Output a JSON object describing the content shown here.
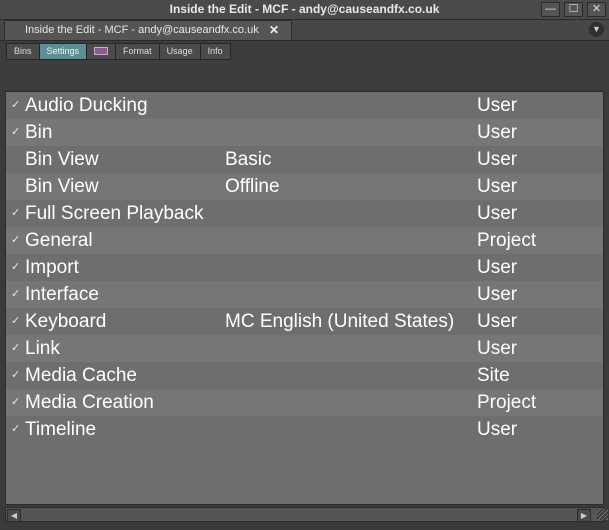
{
  "window": {
    "title": "Inside the Edit - MCF - andy@causeandfx.co.uk",
    "minimize_glyph": "—",
    "maximize_glyph": "☐",
    "close_glyph": "✕"
  },
  "doc_tab": {
    "label": "Inside the Edit - MCF - andy@causeandfx.co.uk",
    "close_glyph": "✕",
    "menu_glyph": "▼"
  },
  "subtabs": [
    {
      "label": "Bins",
      "active": false
    },
    {
      "label": "Settings",
      "active": true
    },
    {
      "label": "",
      "icon": "media-composer-icon",
      "active": false
    },
    {
      "label": "Format",
      "active": false
    },
    {
      "label": "Usage",
      "active": false
    },
    {
      "label": "Info",
      "active": false
    }
  ],
  "settings": [
    {
      "checked": true,
      "name": "Audio Ducking",
      "value": "",
      "type": "User"
    },
    {
      "checked": true,
      "name": "Bin",
      "value": "",
      "type": "User"
    },
    {
      "checked": false,
      "name": "Bin View",
      "value": "Basic",
      "type": "User"
    },
    {
      "checked": false,
      "name": "Bin View",
      "value": "Offline",
      "type": "User"
    },
    {
      "checked": true,
      "name": "Full Screen Playback",
      "value": "",
      "type": "User"
    },
    {
      "checked": true,
      "name": "General",
      "value": "",
      "type": "Project"
    },
    {
      "checked": true,
      "name": "Import",
      "value": "",
      "type": "User"
    },
    {
      "checked": true,
      "name": "Interface",
      "value": "",
      "type": "User"
    },
    {
      "checked": true,
      "name": "Keyboard",
      "value": "MC English (United States)",
      "type": "User"
    },
    {
      "checked": true,
      "name": "Link",
      "value": "",
      "type": "User"
    },
    {
      "checked": true,
      "name": "Media Cache",
      "value": "",
      "type": "Site"
    },
    {
      "checked": true,
      "name": "Media Creation",
      "value": "",
      "type": "Project"
    },
    {
      "checked": true,
      "name": "Timeline",
      "value": "",
      "type": "User"
    }
  ],
  "check_glyph": "✓",
  "scrollbar": {
    "left_glyph": "◀",
    "right_glyph": "▶"
  },
  "colors": {
    "active_tab": "#5d8f94",
    "list_bg": "#6e6e6e",
    "list_alt": "#767676"
  }
}
